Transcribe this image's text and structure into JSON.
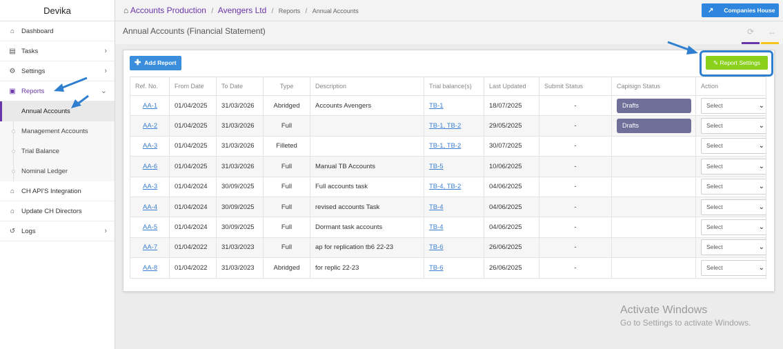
{
  "sidebar": {
    "brand": "Devika",
    "items": [
      {
        "label": "Dashboard",
        "icon": "home-icon"
      },
      {
        "label": "Tasks",
        "icon": "tasks-icon"
      },
      {
        "label": "Settings",
        "icon": "gear-icon"
      },
      {
        "label": "Reports",
        "icon": "report-icon"
      }
    ],
    "sub_items": [
      {
        "label": "Annual Accounts"
      },
      {
        "label": "Management Accounts"
      },
      {
        "label": "Trial Balance"
      },
      {
        "label": "Nominal Ledger"
      }
    ],
    "items_after": [
      {
        "label": "CH API'S Integration",
        "icon": "home-icon"
      },
      {
        "label": "Update CH Directors",
        "icon": "home-icon"
      },
      {
        "label": "Logs",
        "icon": "history-icon"
      }
    ]
  },
  "breadcrumb": {
    "home": "Accounts Production",
    "company": "Avengers Ltd",
    "reports": "Reports",
    "current": "Annual Accounts"
  },
  "topbar": {
    "companies_house": "Companies House"
  },
  "page": {
    "title": "Annual Accounts (Financial Statement)"
  },
  "toolbar": {
    "add_report": "Add Report",
    "report_settings": "Report Settings"
  },
  "table": {
    "headers": [
      "Ref. No.",
      "From Date",
      "To Date",
      "Type",
      "Description",
      "Trial balance(s)",
      "Last Updated",
      "Submit Status",
      "Capisign Status",
      "Action"
    ],
    "rows": [
      {
        "ref": "AA-1",
        "from": "01/04/2025",
        "to": "31/03/2026",
        "type": "Abridged",
        "desc": "Accounts Avengers",
        "tb": "TB-1",
        "updated": "18/07/2025",
        "submit": "-",
        "capisign": "Drafts",
        "action": "Select"
      },
      {
        "ref": "AA-2",
        "from": "01/04/2025",
        "to": "31/03/2026",
        "type": "Full",
        "desc": "",
        "tb": "TB-1, TB-2",
        "updated": "29/05/2025",
        "submit": "-",
        "capisign": "Drafts",
        "action": "Select"
      },
      {
        "ref": "AA-3",
        "from": "01/04/2025",
        "to": "31/03/2026",
        "type": "Filleted",
        "desc": "",
        "tb": "TB-1, TB-2",
        "updated": "30/07/2025",
        "submit": "-",
        "capisign": "",
        "action": "Select"
      },
      {
        "ref": "AA-6",
        "from": "01/04/2025",
        "to": "31/03/2026",
        "type": "Full",
        "desc": "Manual TB Accounts",
        "tb": "TB-5",
        "updated": "10/06/2025",
        "submit": "-",
        "capisign": "",
        "action": "Select"
      },
      {
        "ref": "AA-3",
        "from": "01/04/2024",
        "to": "30/09/2025",
        "type": "Full",
        "desc": "Full accounts task",
        "tb": "TB-4, TB-2",
        "updated": "04/06/2025",
        "submit": "-",
        "capisign": "",
        "action": "Select"
      },
      {
        "ref": "AA-4",
        "from": "01/04/2024",
        "to": "30/09/2025",
        "type": "Full",
        "desc": "revised accounts Task",
        "tb": "TB-4",
        "updated": "04/06/2025",
        "submit": "-",
        "capisign": "",
        "action": "Select"
      },
      {
        "ref": "AA-5",
        "from": "01/04/2024",
        "to": "30/09/2025",
        "type": "Full",
        "desc": "Dormant task accounts",
        "tb": "TB-4",
        "updated": "04/06/2025",
        "submit": "-",
        "capisign": "",
        "action": "Select"
      },
      {
        "ref": "AA-7",
        "from": "01/04/2022",
        "to": "31/03/2023",
        "type": "Full",
        "desc": "ap for replication tb6 22-23",
        "tb": "TB-6",
        "updated": "26/06/2025",
        "submit": "-",
        "capisign": "",
        "action": "Select"
      },
      {
        "ref": "AA-8",
        "from": "01/04/2022",
        "to": "31/03/2023",
        "type": "Abridged",
        "desc": "for replic 22-23",
        "tb": "TB-6",
        "updated": "26/06/2025",
        "submit": "-",
        "capisign": "",
        "action": "Select"
      }
    ]
  },
  "watermark": {
    "line1": "Activate Windows",
    "line2": "Go to Settings to activate Windows."
  },
  "colors": {
    "brand_purple": "#6a35a8",
    "primary_blue": "#3b8edb",
    "settings_green": "#8bd11c",
    "drafts_badge": "#6f6f9a",
    "highlight_blue": "#2f7fd0"
  }
}
